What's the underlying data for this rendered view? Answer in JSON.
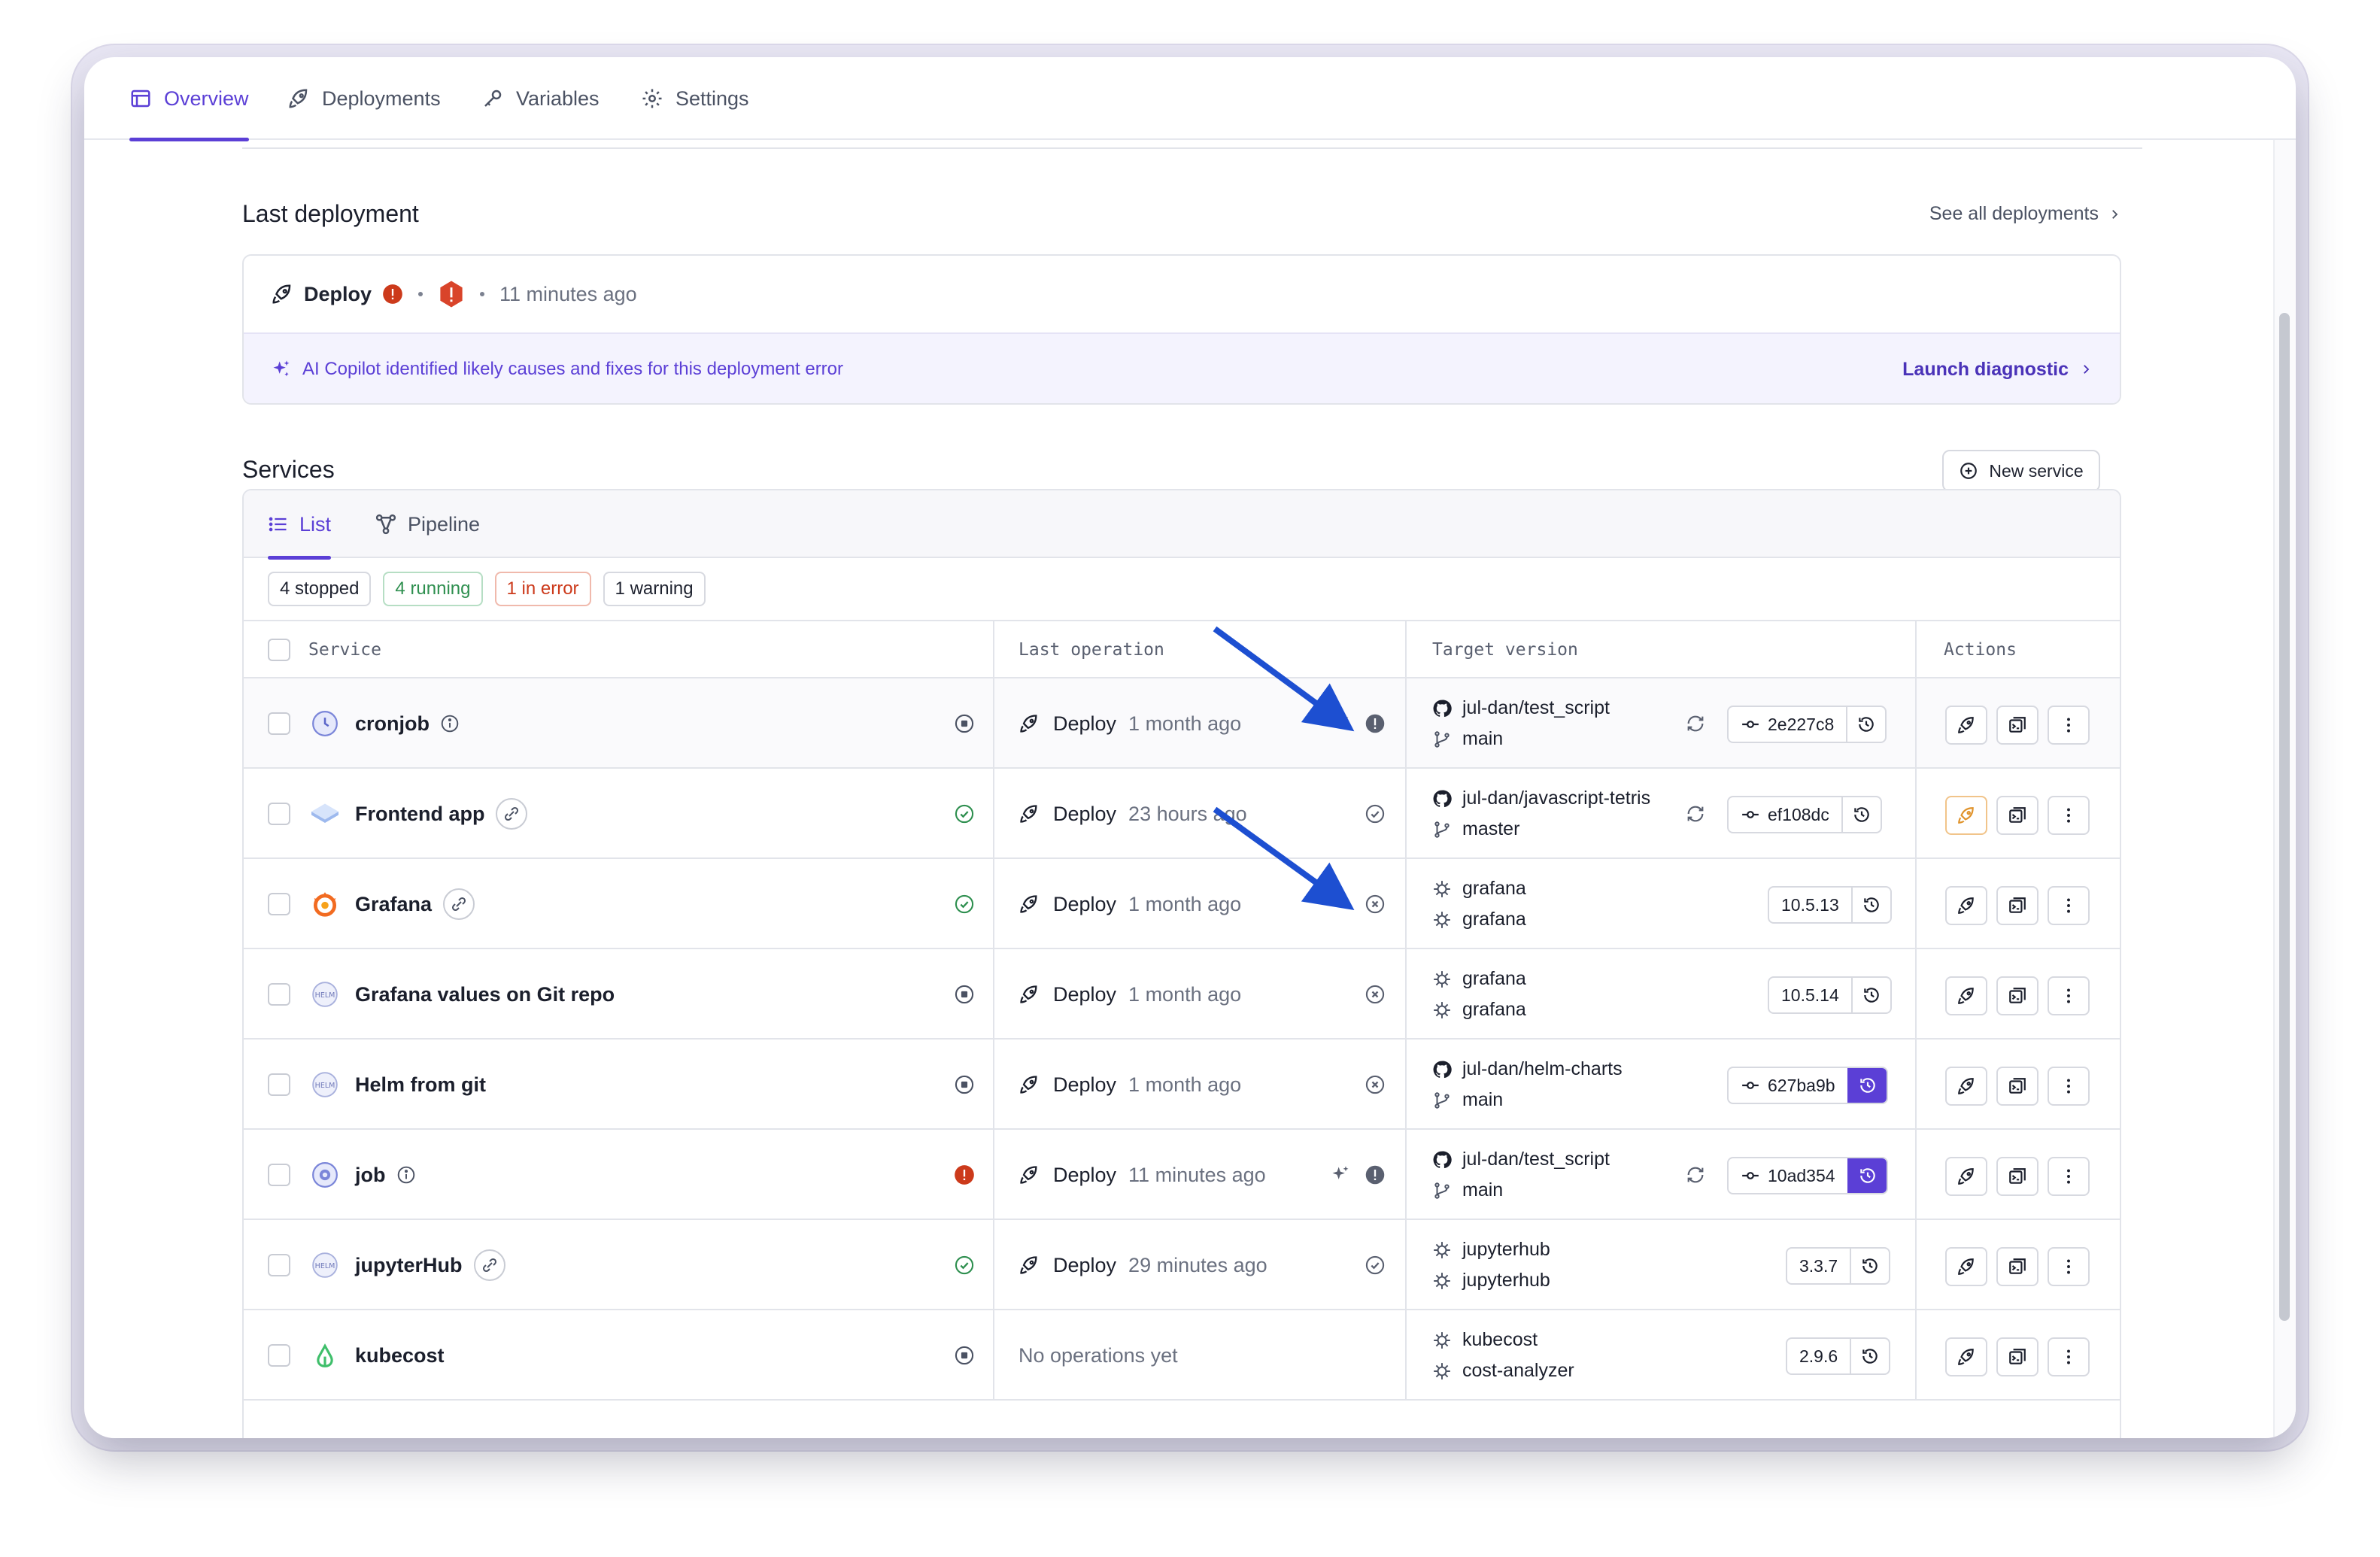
{
  "tabs": [
    {
      "label": "Overview",
      "icon": "layout-icon",
      "active": true
    },
    {
      "label": "Deployments",
      "icon": "rocket-icon"
    },
    {
      "label": "Variables",
      "icon": "key-icon"
    },
    {
      "label": "Settings",
      "icon": "gear-icon"
    }
  ],
  "last_deployment": {
    "title": "Last deployment",
    "see_all": "See all deployments",
    "action": "Deploy",
    "time": "11 minutes ago",
    "copilot_text": "AI Copilot identified likely causes and fixes for this deployment error",
    "launch_label": "Launch diagnostic"
  },
  "services": {
    "title": "Services",
    "new_service_label": "New service",
    "sub_tabs": [
      {
        "label": "List",
        "active": true
      },
      {
        "label": "Pipeline"
      }
    ],
    "filters": [
      "4 stopped",
      "4 running",
      "1 in error",
      "1 warning"
    ],
    "columns": [
      "Service",
      "Last operation",
      "Target version",
      "Actions"
    ],
    "rows": [
      {
        "name": "cronjob",
        "extra": "info",
        "status": "stopped",
        "op": "Deploy",
        "time": "1 month ago",
        "op_status": "error-grey",
        "ai": true,
        "ver_type": "git",
        "ver1": "jul-dan/test_script",
        "ver2": "main",
        "sync": true,
        "version": "2e227c8",
        "version_kind": "commit",
        "hist_purple": false,
        "deploy_highlight": false
      },
      {
        "name": "Frontend app",
        "extra": "link",
        "status": "running",
        "op": "Deploy",
        "time": "23 hours ago",
        "op_status": "ok",
        "ai": false,
        "ver_type": "git",
        "ver1": "jul-dan/javascript-tetris",
        "ver2": "master",
        "sync": true,
        "version": "ef108dc",
        "version_kind": "commit",
        "hist_purple": false,
        "deploy_highlight": true
      },
      {
        "name": "Grafana",
        "extra": "link",
        "status": "running",
        "op": "Deploy",
        "time": "1 month ago",
        "op_status": "cancel",
        "ai": false,
        "ver_type": "helm",
        "ver1": "grafana",
        "ver2": "grafana",
        "sync": false,
        "version": "10.5.13",
        "version_kind": "chart",
        "hist_purple": false,
        "deploy_highlight": false
      },
      {
        "name": "Grafana values on Git repo",
        "extra": "",
        "status": "stopped",
        "op": "Deploy",
        "time": "1 month ago",
        "op_status": "cancel",
        "ai": false,
        "ver_type": "helm",
        "ver1": "grafana",
        "ver2": "grafana",
        "sync": false,
        "version": "10.5.14",
        "version_kind": "chart",
        "hist_purple": false,
        "deploy_highlight": false
      },
      {
        "name": "Helm from git",
        "extra": "",
        "status": "stopped",
        "op": "Deploy",
        "time": "1 month ago",
        "op_status": "cancel",
        "ai": false,
        "ver_type": "git",
        "ver1": "jul-dan/helm-charts",
        "ver2": "main",
        "sync": false,
        "version": "627ba9b",
        "version_kind": "commit",
        "hist_purple": true,
        "deploy_highlight": false
      },
      {
        "name": "job",
        "extra": "info",
        "status": "error",
        "op": "Deploy",
        "time": "11 minutes ago",
        "op_status": "error-grey",
        "ai": true,
        "ver_type": "git",
        "ver1": "jul-dan/test_script",
        "ver2": "main",
        "sync": true,
        "version": "10ad354",
        "version_kind": "commit",
        "hist_purple": true,
        "deploy_highlight": false
      },
      {
        "name": "jupyterHub",
        "extra": "link",
        "status": "running",
        "op": "Deploy",
        "time": "29 minutes ago",
        "op_status": "ok",
        "ai": false,
        "ver_type": "helm",
        "ver1": "jupyterhub",
        "ver2": "jupyterhub",
        "sync": false,
        "version": "3.3.7",
        "version_kind": "chart",
        "hist_purple": false,
        "deploy_highlight": false
      },
      {
        "name": "kubecost",
        "extra": "",
        "status": "stopped",
        "op": "",
        "time": "No operations yet",
        "op_status": "",
        "ai": false,
        "ver_type": "helm",
        "ver1": "kubecost",
        "ver2": "cost-analyzer",
        "sync": false,
        "version": "2.9.6",
        "version_kind": "chart",
        "hist_purple": false,
        "deploy_highlight": false
      }
    ]
  },
  "colors": {
    "accent": "#5b3fd6",
    "error": "#cc3a1b",
    "success": "#2e8f4f",
    "annotation_arrow": "#1d4fd1"
  }
}
